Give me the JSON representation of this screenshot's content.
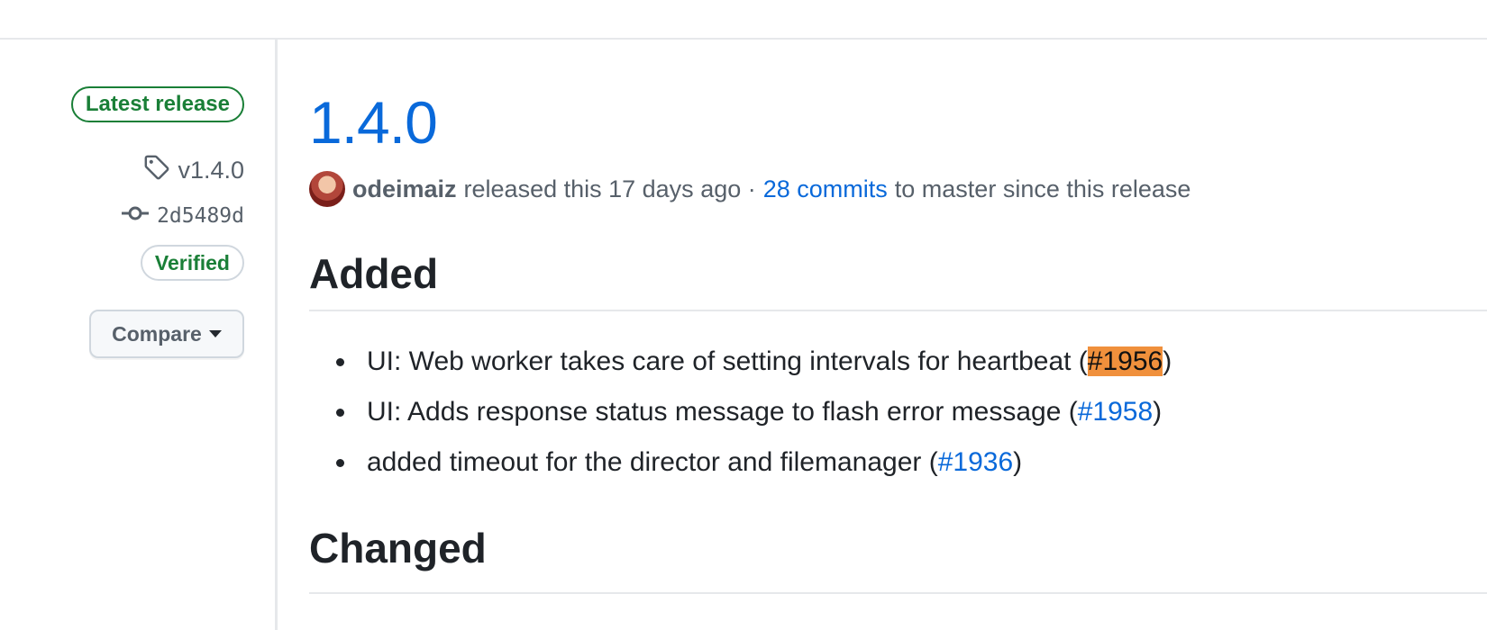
{
  "sidebar": {
    "latest_badge": "Latest release",
    "tag_icon": "tag-icon",
    "tag": "v1.4.0",
    "commit_icon": "git-commit-icon",
    "commit": "2d5489d",
    "verified_badge": "Verified",
    "compare_button": "Compare",
    "compare_caret_icon": "caret-down-icon"
  },
  "release": {
    "title": "1.4.0",
    "author": "odeimaiz",
    "released_text": "released this 17 days ago ·",
    "commits_link": "28 commits",
    "commits_suffix": "to master since this release"
  },
  "sections": {
    "added": {
      "heading": "Added",
      "items": [
        {
          "text": "UI: Web worker takes care of setting intervals for heartbeat (",
          "issue": "#1956",
          "close": ")",
          "highlighted": true
        },
        {
          "text": "UI: Adds response status message to flash error message (",
          "issue": "#1958",
          "close": ")",
          "highlighted": false
        },
        {
          "text": "added timeout for the director and filemanager (",
          "issue": "#1936",
          "close": ")",
          "highlighted": false
        }
      ]
    },
    "changed": {
      "heading": "Changed"
    }
  },
  "colors": {
    "link": "#0969da",
    "success": "#1a7f37",
    "highlight": "#f0903c",
    "border": "#d0d7de"
  }
}
